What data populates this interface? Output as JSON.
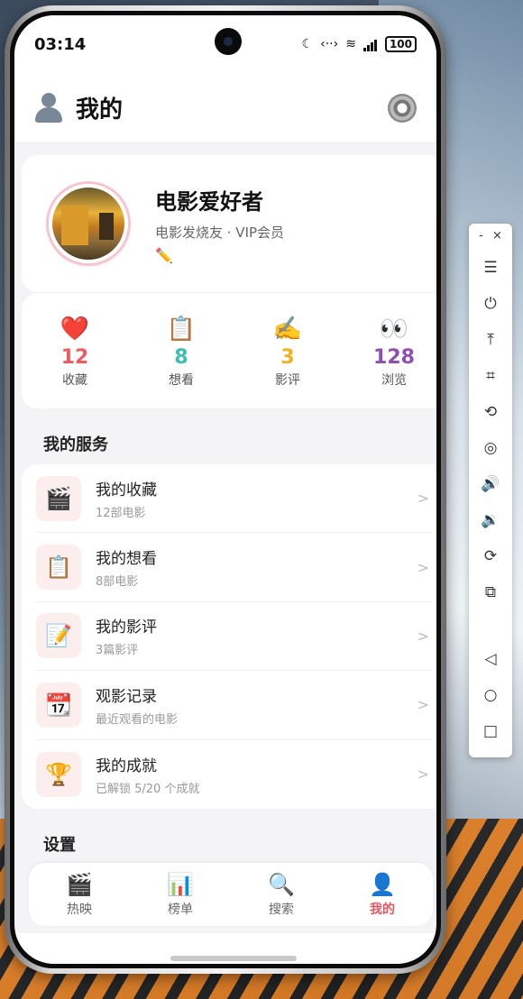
{
  "status_bar": {
    "time": "03:14",
    "battery": "100"
  },
  "header": {
    "title": "我的"
  },
  "profile": {
    "name": "电影爱好者",
    "subtitle": "电影发烧友 · VIP会员",
    "edit_icon": "✏️"
  },
  "stats": [
    {
      "emoji": "❤️",
      "value": "12",
      "label": "收藏",
      "color": "#ef5b61"
    },
    {
      "emoji": "📋",
      "value": "8",
      "label": "想看",
      "color": "#3bbfb0"
    },
    {
      "emoji": "✍️",
      "value": "3",
      "label": "影评",
      "color": "#f1b420"
    },
    {
      "emoji": "👀",
      "value": "128",
      "label": "浏览",
      "color": "#8e4fb0"
    }
  ],
  "sections": {
    "services_title": "我的服务",
    "settings_title": "设置"
  },
  "services": [
    {
      "icon": "🎬",
      "title": "我的收藏",
      "subtitle": "12部电影",
      "arrow": ">"
    },
    {
      "icon": "📋",
      "title": "我的想看",
      "subtitle": "8部电影",
      "arrow": ">"
    },
    {
      "icon": "📝",
      "title": "我的影评",
      "subtitle": "3篇影评",
      "arrow": ">"
    },
    {
      "icon": "📆",
      "title": "观影记录",
      "subtitle": "最近观看的电影",
      "arrow": ">"
    },
    {
      "icon": "🏆",
      "title": "我的成就",
      "subtitle": "已解锁 5/20 个成就",
      "arrow": ">"
    }
  ],
  "tabs": [
    {
      "icon": "🎬",
      "label": "热映"
    },
    {
      "icon": "📊",
      "label": "榜单"
    },
    {
      "icon": "🔍",
      "label": "搜索"
    },
    {
      "icon": "👤",
      "label": "我的"
    }
  ],
  "side_toolbar": {
    "minimize": "-",
    "close": "×",
    "buttons": [
      "☰",
      "⏻",
      "⤒",
      "⌗",
      "⟲",
      "◎",
      "🔊",
      "🔉",
      "⟳",
      "⧉",
      "◁",
      "○",
      "□"
    ]
  },
  "colors": {
    "accent": "#e8545f",
    "card_bg": "#ffffff",
    "page_bg": "#f4f4f6"
  }
}
